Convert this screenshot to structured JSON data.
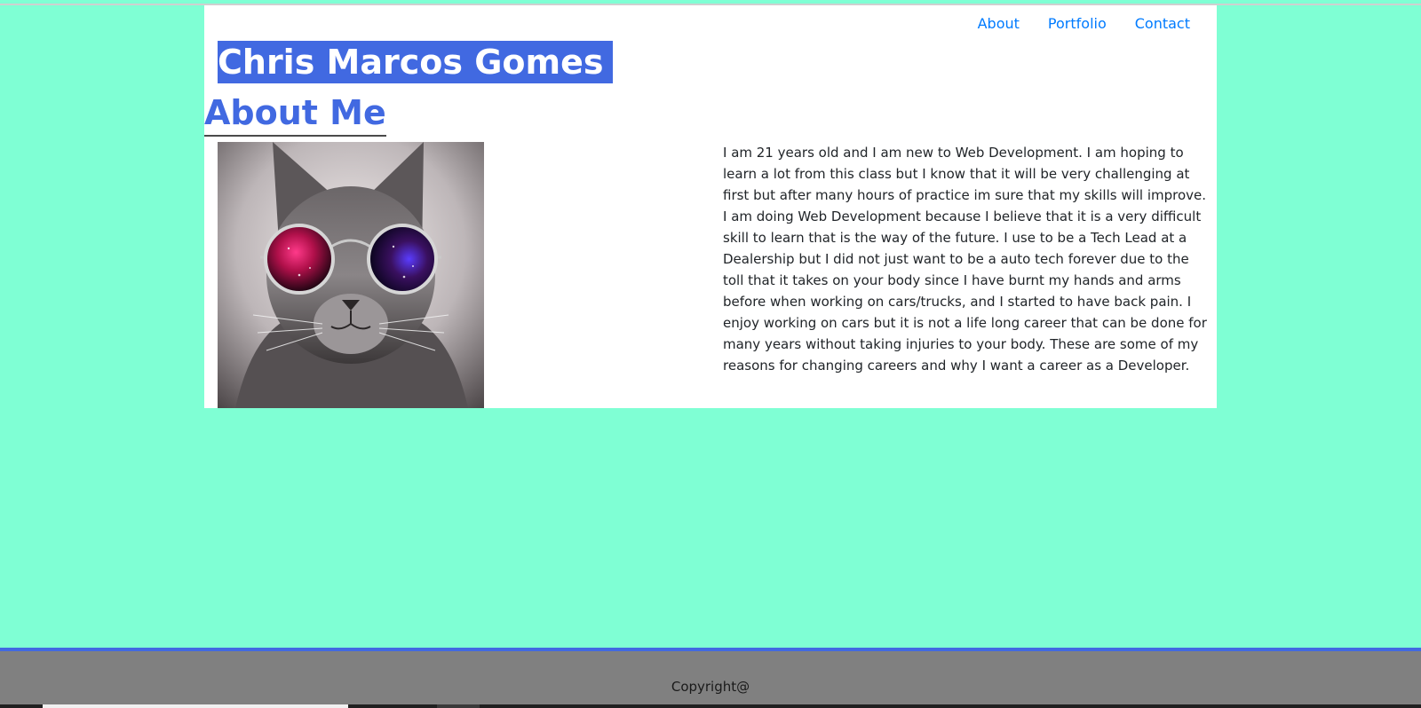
{
  "nav": {
    "items": [
      {
        "label": "About"
      },
      {
        "label": "Portfolio"
      },
      {
        "label": "Contact"
      }
    ]
  },
  "header": {
    "name": "Chris Marcos Gomes"
  },
  "about": {
    "heading": "About Me",
    "photo_icon": "cat-with-galaxy-sunglasses-photo",
    "bio": "I am 21 years old and I am new to Web Development. I am hoping to learn a lot from this class but I know that it will be very challenging at first but after many hours of practice im sure that my skills will improve. I am doing Web Development because I believe that it is a very difficult skill to learn that is the way of the future. I use to be a Tech Lead at a Dealership but I did not just want to be a auto tech forever due to the toll that it takes on your body since I have burnt my hands and arms before when working on cars/trucks, and I started to have back pain. I enjoy working on cars but it is not a life long career that can be done for many years without taking injuries to your body. These are some of my reasons for changing careers and why I want a career as a Developer."
  },
  "footer": {
    "copyright": "Copyright@"
  },
  "colors": {
    "page_background": "#7fffd4",
    "accent": "#4169e1",
    "nav_link": "#007bff",
    "footer": "#808080"
  }
}
